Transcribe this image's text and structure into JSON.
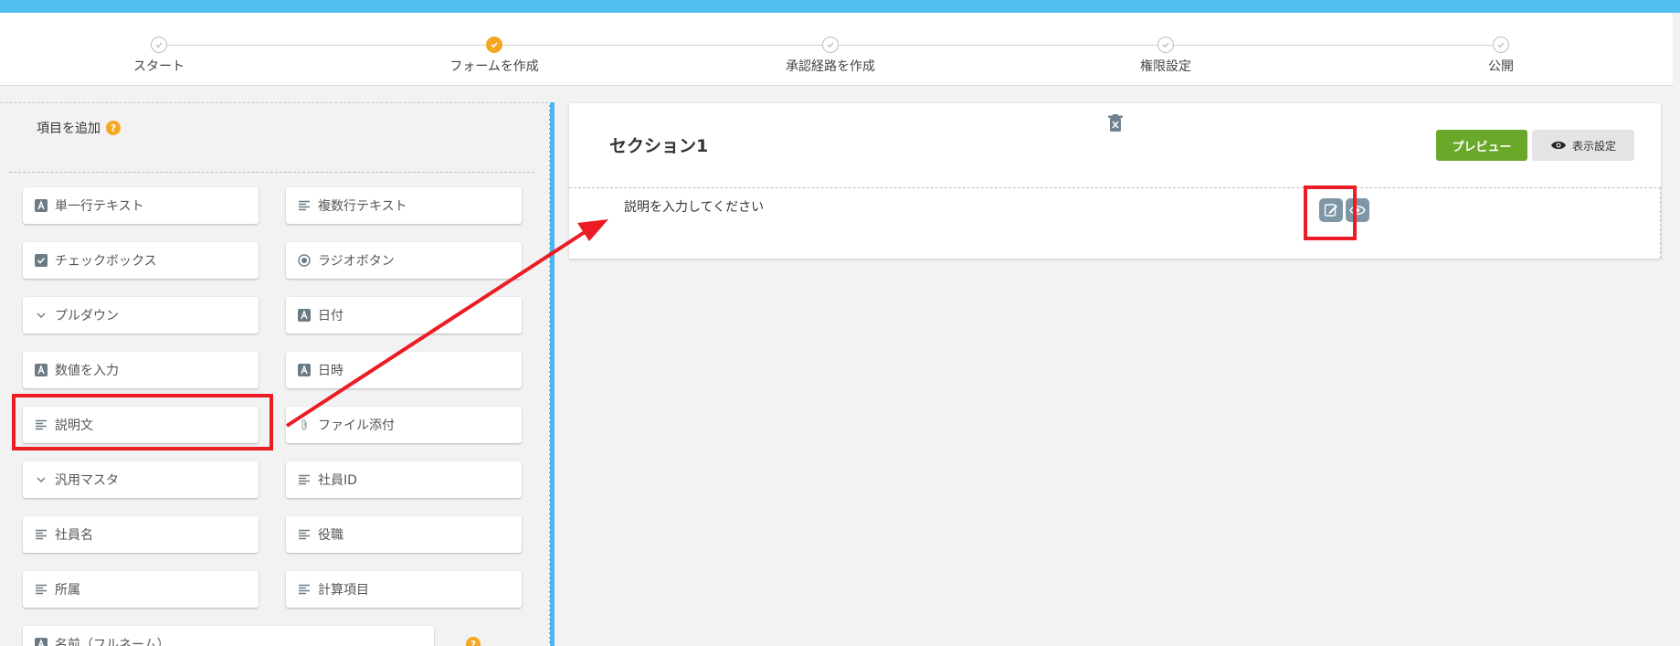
{
  "stepper": {
    "steps": [
      {
        "label": "スタート",
        "state": "done"
      },
      {
        "label": "フォームを作成",
        "state": "active"
      },
      {
        "label": "承認経路を作成",
        "state": "pending"
      },
      {
        "label": "権限設定",
        "state": "pending"
      },
      {
        "label": "公開",
        "state": "pending"
      }
    ]
  },
  "palette": {
    "title": "項目を追加",
    "help": "?",
    "items": [
      {
        "label": "単一行テキスト",
        "icon": "text-a-icon"
      },
      {
        "label": "複数行テキスト",
        "icon": "lines-icon"
      },
      {
        "label": "チェックボックス",
        "icon": "checkbox-icon"
      },
      {
        "label": "ラジオボタン",
        "icon": "radio-icon"
      },
      {
        "label": "プルダウン",
        "icon": "chevron-down-icon"
      },
      {
        "label": "日付",
        "icon": "text-a-icon"
      },
      {
        "label": "数値を入力",
        "icon": "text-a-icon"
      },
      {
        "label": "日時",
        "icon": "text-a-icon"
      },
      {
        "label": "説明文",
        "icon": "lines-icon"
      },
      {
        "label": "ファイル添付",
        "icon": "paperclip-icon"
      },
      {
        "label": "汎用マスタ",
        "icon": "chevron-down-icon"
      },
      {
        "label": "社員ID",
        "icon": "lines-icon"
      },
      {
        "label": "社員名",
        "icon": "lines-icon"
      },
      {
        "label": "役職",
        "icon": "lines-icon"
      },
      {
        "label": "所属",
        "icon": "lines-icon"
      },
      {
        "label": "計算項目",
        "icon": "lines-icon"
      },
      {
        "label": "名前（フルネーム）",
        "icon": "text-a-icon"
      }
    ]
  },
  "section": {
    "title": "セクション1",
    "preview_label": "プレビュー",
    "display_label": "表示設定",
    "description_placeholder": "説明を入力してください"
  },
  "colors": {
    "accent_blue": "#52c0ef",
    "active_orange": "#f5a623",
    "preview_green": "#6aa82a",
    "highlight_red": "#ec1c24"
  }
}
